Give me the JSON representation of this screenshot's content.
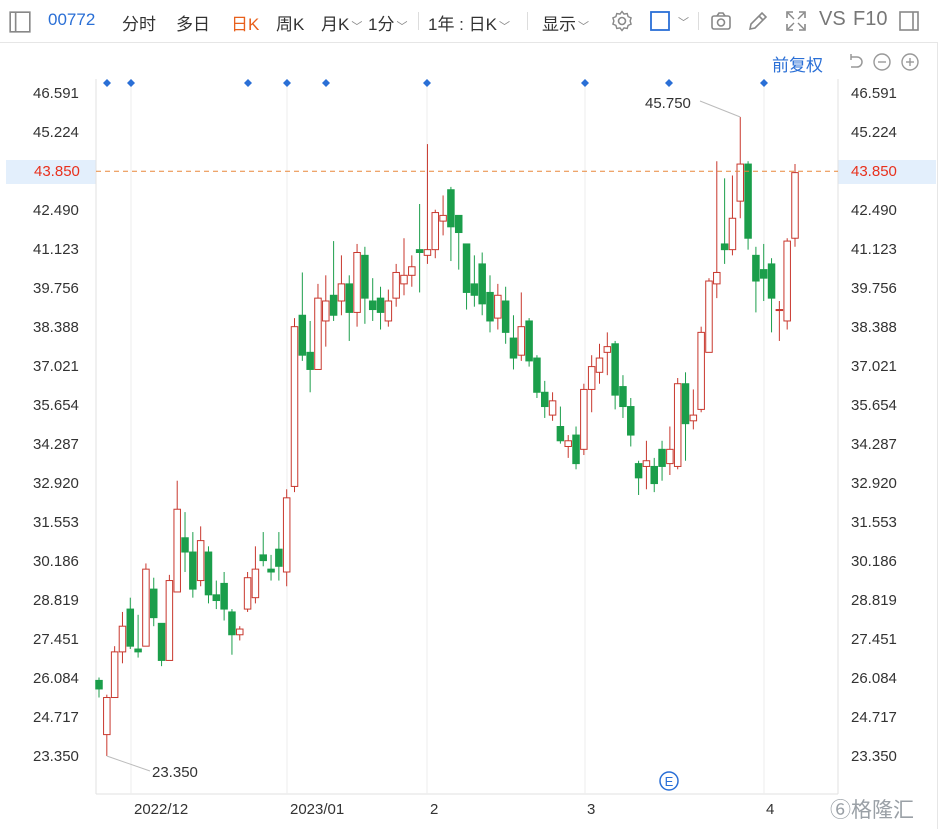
{
  "toolbar": {
    "code": "00772",
    "items": [
      "分时",
      "多日",
      "日K",
      "周K",
      "月K",
      "1分"
    ],
    "active": "日K",
    "range": "1年 : 日K",
    "display": "显示",
    "vs": "VS",
    "f10": "F10"
  },
  "subbar": {
    "adjust": "前复权"
  },
  "colors": {
    "up": "#c8372d",
    "down": "#1b9e4b",
    "ref": "#e8873a",
    "accent": "#2a6fd6"
  },
  "chart_data": {
    "type": "candlestick",
    "y_ticks": [
      "46.591",
      "45.224",
      "43.850",
      "42.490",
      "41.123",
      "39.756",
      "38.388",
      "37.021",
      "35.654",
      "34.287",
      "32.920",
      "31.553",
      "30.186",
      "28.819",
      "27.451",
      "26.084",
      "24.717",
      "23.350"
    ],
    "x_labels": [
      "2022/12",
      "2023/01",
      "2",
      "3",
      "4"
    ],
    "ylim": [
      23.35,
      46.591
    ],
    "reference_price": "43.850",
    "max_annotation": "45.750",
    "min_annotation": "23.350",
    "event_marker": "E",
    "candles": [
      {
        "o": 26.0,
        "c": 25.7,
        "h": 26.1,
        "l": 25.4
      },
      {
        "o": 24.1,
        "c": 25.4,
        "h": 25.5,
        "l": 23.35
      },
      {
        "o": 25.4,
        "c": 27.0,
        "h": 27.2,
        "l": 25.4
      },
      {
        "o": 27.0,
        "c": 27.9,
        "h": 28.4,
        "l": 26.6
      },
      {
        "o": 28.5,
        "c": 27.2,
        "h": 28.9,
        "l": 27.1
      },
      {
        "o": 27.1,
        "c": 27.0,
        "h": 28.3,
        "l": 26.8
      },
      {
        "o": 27.2,
        "c": 29.9,
        "h": 30.1,
        "l": 27.2
      },
      {
        "o": 29.2,
        "c": 28.2,
        "h": 29.6,
        "l": 27.9
      },
      {
        "o": 28.0,
        "c": 26.7,
        "h": 28.0,
        "l": 26.5
      },
      {
        "o": 26.7,
        "c": 29.5,
        "h": 29.7,
        "l": 26.7
      },
      {
        "o": 29.1,
        "c": 32.0,
        "h": 33.0,
        "l": 29.1
      },
      {
        "o": 31.0,
        "c": 30.5,
        "h": 31.9,
        "l": 29.8
      },
      {
        "o": 30.5,
        "c": 29.2,
        "h": 31.2,
        "l": 28.9
      },
      {
        "o": 29.5,
        "c": 30.9,
        "h": 31.4,
        "l": 29.3
      },
      {
        "o": 30.5,
        "c": 29.0,
        "h": 30.7,
        "l": 28.7
      },
      {
        "o": 29.0,
        "c": 28.8,
        "h": 29.5,
        "l": 28.5
      },
      {
        "o": 29.4,
        "c": 28.5,
        "h": 29.8,
        "l": 28.1
      },
      {
        "o": 28.4,
        "c": 27.6,
        "h": 28.5,
        "l": 26.9
      },
      {
        "o": 27.6,
        "c": 27.8,
        "h": 27.9,
        "l": 27.4
      },
      {
        "o": 28.5,
        "c": 29.6,
        "h": 29.8,
        "l": 28.4
      },
      {
        "o": 28.9,
        "c": 29.9,
        "h": 30.7,
        "l": 28.7
      },
      {
        "o": 30.4,
        "c": 30.2,
        "h": 31.2,
        "l": 30.0
      },
      {
        "o": 29.9,
        "c": 29.8,
        "h": 30.4,
        "l": 29.5
      },
      {
        "o": 30.6,
        "c": 30.0,
        "h": 31.2,
        "l": 29.5
      },
      {
        "o": 29.8,
        "c": 32.4,
        "h": 32.7,
        "l": 29.3
      },
      {
        "o": 32.8,
        "c": 38.4,
        "h": 38.7,
        "l": 32.6
      },
      {
        "o": 38.8,
        "c": 37.4,
        "h": 40.3,
        "l": 37.2
      },
      {
        "o": 37.5,
        "c": 36.9,
        "h": 38.6,
        "l": 36.1
      },
      {
        "o": 36.9,
        "c": 39.4,
        "h": 39.9,
        "l": 36.9
      },
      {
        "o": 38.6,
        "c": 39.3,
        "h": 40.2,
        "l": 37.7
      },
      {
        "o": 39.5,
        "c": 38.8,
        "h": 41.4,
        "l": 38.6
      },
      {
        "o": 39.3,
        "c": 39.9,
        "h": 40.9,
        "l": 38.8
      },
      {
        "o": 39.9,
        "c": 38.9,
        "h": 40.2,
        "l": 37.9
      },
      {
        "o": 38.9,
        "c": 41.0,
        "h": 41.3,
        "l": 38.4
      },
      {
        "o": 40.9,
        "c": 39.4,
        "h": 41.2,
        "l": 38.5
      },
      {
        "o": 39.3,
        "c": 39.0,
        "h": 40.1,
        "l": 38.6
      },
      {
        "o": 39.4,
        "c": 38.9,
        "h": 39.8,
        "l": 38.3
      },
      {
        "o": 38.6,
        "c": 39.3,
        "h": 39.7,
        "l": 38.4
      },
      {
        "o": 39.4,
        "c": 40.3,
        "h": 40.6,
        "l": 39.1
      },
      {
        "o": 39.9,
        "c": 40.2,
        "h": 41.5,
        "l": 39.5
      },
      {
        "o": 40.2,
        "c": 40.5,
        "h": 40.9,
        "l": 39.8
      },
      {
        "o": 41.1,
        "c": 41.0,
        "h": 42.7,
        "l": 39.6
      },
      {
        "o": 40.9,
        "c": 41.1,
        "h": 44.8,
        "l": 40.6
      },
      {
        "o": 41.1,
        "c": 42.4,
        "h": 42.5,
        "l": 40.8
      },
      {
        "o": 42.1,
        "c": 42.3,
        "h": 43.0,
        "l": 41.6
      },
      {
        "o": 43.2,
        "c": 41.9,
        "h": 43.3,
        "l": 40.7
      },
      {
        "o": 42.3,
        "c": 41.7,
        "h": 42.3,
        "l": 40.4
      },
      {
        "o": 41.3,
        "c": 39.6,
        "h": 41.3,
        "l": 39.0
      },
      {
        "o": 39.9,
        "c": 39.5,
        "h": 40.9,
        "l": 39.1
      },
      {
        "o": 40.6,
        "c": 39.2,
        "h": 41.0,
        "l": 38.8
      },
      {
        "o": 39.6,
        "c": 38.6,
        "h": 40.2,
        "l": 38.2
      },
      {
        "o": 38.7,
        "c": 39.5,
        "h": 39.9,
        "l": 38.3
      },
      {
        "o": 39.3,
        "c": 38.2,
        "h": 39.8,
        "l": 37.8
      },
      {
        "o": 38.0,
        "c": 37.3,
        "h": 38.8,
        "l": 36.9
      },
      {
        "o": 37.4,
        "c": 38.4,
        "h": 39.6,
        "l": 37.2
      },
      {
        "o": 38.6,
        "c": 37.2,
        "h": 38.7,
        "l": 37.0
      },
      {
        "o": 37.3,
        "c": 36.1,
        "h": 37.4,
        "l": 35.9
      },
      {
        "o": 36.1,
        "c": 35.6,
        "h": 36.5,
        "l": 35.2
      },
      {
        "o": 35.3,
        "c": 35.8,
        "h": 36.1,
        "l": 35.1
      },
      {
        "o": 34.9,
        "c": 34.4,
        "h": 35.6,
        "l": 34.3
      },
      {
        "o": 34.2,
        "c": 34.4,
        "h": 34.6,
        "l": 33.8
      },
      {
        "o": 34.6,
        "c": 33.6,
        "h": 34.9,
        "l": 33.4
      },
      {
        "o": 34.1,
        "c": 36.2,
        "h": 36.4,
        "l": 33.9
      },
      {
        "o": 36.2,
        "c": 37.0,
        "h": 37.4,
        "l": 35.4
      },
      {
        "o": 36.8,
        "c": 37.3,
        "h": 37.8,
        "l": 36.4
      },
      {
        "o": 37.5,
        "c": 37.7,
        "h": 38.2,
        "l": 36.7
      },
      {
        "o": 37.8,
        "c": 36.0,
        "h": 37.9,
        "l": 35.5
      },
      {
        "o": 36.3,
        "c": 35.6,
        "h": 36.7,
        "l": 35.2
      },
      {
        "o": 35.6,
        "c": 34.6,
        "h": 35.9,
        "l": 34.2
      },
      {
        "o": 33.6,
        "c": 33.1,
        "h": 33.7,
        "l": 32.5
      },
      {
        "o": 33.5,
        "c": 33.7,
        "h": 34.4,
        "l": 32.7
      },
      {
        "o": 33.5,
        "c": 32.9,
        "h": 33.8,
        "l": 32.6
      },
      {
        "o": 34.1,
        "c": 33.5,
        "h": 34.4,
        "l": 33.0
      },
      {
        "o": 33.6,
        "c": 34.1,
        "h": 34.9,
        "l": 33.2
      },
      {
        "o": 33.5,
        "c": 36.4,
        "h": 36.6,
        "l": 33.4
      },
      {
        "o": 36.4,
        "c": 35.0,
        "h": 36.8,
        "l": 33.7
      },
      {
        "o": 35.1,
        "c": 35.3,
        "h": 36.2,
        "l": 34.8
      },
      {
        "o": 35.5,
        "c": 38.2,
        "h": 38.4,
        "l": 35.4
      },
      {
        "o": 37.5,
        "c": 40.0,
        "h": 40.1,
        "l": 37.5
      },
      {
        "o": 39.9,
        "c": 40.3,
        "h": 44.2,
        "l": 39.4
      },
      {
        "o": 41.3,
        "c": 41.1,
        "h": 43.6,
        "l": 40.6
      },
      {
        "o": 41.1,
        "c": 42.2,
        "h": 43.7,
        "l": 40.9
      },
      {
        "o": 42.8,
        "c": 44.1,
        "h": 45.75,
        "l": 42.2
      },
      {
        "o": 44.1,
        "c": 41.5,
        "h": 44.2,
        "l": 41.1
      },
      {
        "o": 40.9,
        "c": 40.0,
        "h": 41.2,
        "l": 38.9
      },
      {
        "o": 40.4,
        "c": 40.1,
        "h": 41.3,
        "l": 39.3
      },
      {
        "o": 40.6,
        "c": 39.4,
        "h": 40.8,
        "l": 38.2
      },
      {
        "o": 39.0,
        "c": 39.0,
        "h": 39.3,
        "l": 37.9
      },
      {
        "o": 38.6,
        "c": 41.4,
        "h": 41.5,
        "l": 38.3
      },
      {
        "o": 41.5,
        "c": 43.8,
        "h": 44.1,
        "l": 41.2
      }
    ]
  }
}
